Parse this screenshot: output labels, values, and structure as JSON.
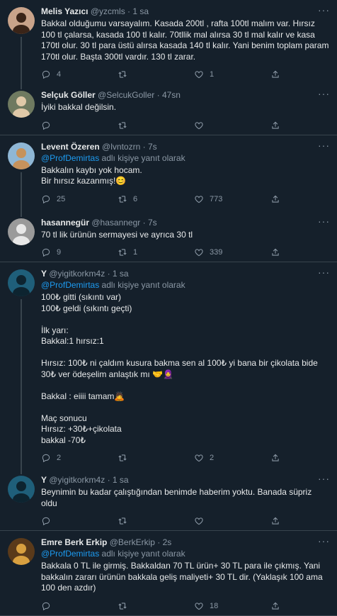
{
  "tweets": [
    {
      "name": "Melis Yazıcı",
      "handle": "@yzcmls",
      "time": "1 sa",
      "reply_prefix": "",
      "reply_mention": "",
      "reply_suffix": "",
      "text": "Bakkal olduğumu varsayalım. Kasada 200tl , rafta 100tl malım var. Hırsız 100 tl çalarsa, kasada 100 tl kalır. 70tllik mal alırsa 30 tl mal kalır ve kasa 170tl olur. 30 tl para üstü alırsa kasada 140 tl kalır. Yani benim toplam param 170tl olur. Başta 300tl vardır. 130 tl zarar.",
      "replies": "4",
      "retweets": "",
      "likes": "1",
      "avatar": {
        "bg": "#c9a38a",
        "fg": "#3a2418"
      }
    },
    {
      "name": "Selçuk Göller",
      "handle": "@SelcukGoller",
      "time": "47sn",
      "reply_prefix": "",
      "reply_mention": "",
      "reply_suffix": "",
      "text": "İyiki bakkal değilsin.",
      "replies": "",
      "retweets": "",
      "likes": "",
      "avatar": {
        "bg": "#6f7a60",
        "fg": "#e0c9a8"
      }
    },
    {
      "name": "Levent Özeren",
      "handle": "@lvntozrn",
      "time": "7s",
      "reply_prefix": "",
      "reply_mention": "@ProfDemirtas",
      "reply_suffix": " adlı kişiye yanıt olarak",
      "text": "Bakkalın kaybı yok hocam.\nBir hırsız kazanmış!😊",
      "replies": "25",
      "retweets": "6",
      "likes": "773",
      "avatar": {
        "bg": "#8fb7d6",
        "fg": "#c6925c"
      }
    },
    {
      "name": "hasannegür",
      "handle": "@hasannegr",
      "time": "7s",
      "reply_prefix": "",
      "reply_mention": "",
      "reply_suffix": "",
      "text": "70 tl lik ürünün sermayesi ve ayrıca 30 tl",
      "replies": "9",
      "retweets": "1",
      "likes": "339",
      "avatar": {
        "bg": "#9a9a9a",
        "fg": "#e8e8e8"
      }
    },
    {
      "name": "Y",
      "handle": "@yigitkorkm4z",
      "time": "1 sa",
      "reply_prefix": "",
      "reply_mention": "@ProfDemirtas",
      "reply_suffix": " adlı kişiye yanıt olarak",
      "text": "100₺ gitti (sıkıntı var)\n100₺ geldi (sıkıntı geçti)\n\nİlk yarı:\nBakkal:1 hırsız:1\n\nHırsız: 100₺ ni çaldım kusura bakma sen al 100₺ yi bana bir çikolata bide 30₺ ver ödeşelim anlaştık mı 🤝🧕\n\nBakkal : eiiii tamam🙇\n\nMaç sonucu\nHırsız: +30₺+çikolata\nbakkal -70₺",
      "replies": "2",
      "retweets": "",
      "likes": "2",
      "avatar": {
        "bg": "#1f5f7a",
        "fg": "#0d2430"
      }
    },
    {
      "name": "Y",
      "handle": "@yigitkorkm4z",
      "time": "1 sa",
      "reply_prefix": "",
      "reply_mention": "",
      "reply_suffix": "",
      "text": "Beynimin bu kadar çalıştığından benimde haberim yoktu. Banada süpriz oldu",
      "replies": "",
      "retweets": "",
      "likes": "",
      "avatar": {
        "bg": "#1f5f7a",
        "fg": "#0d2430"
      }
    },
    {
      "name": "Emre Berk Erkip",
      "handle": "@BerkErkip",
      "time": "2s",
      "reply_prefix": "",
      "reply_mention": "@ProfDemirtas",
      "reply_suffix": " adlı kişiye yanıt olarak",
      "text": "Bakkala 0 TL ile girmiş. Bakkaldan 70 TL ürün+ 30 TL para ile çıkmış. Yani bakkalın zararı ürünün bakkala geliş maliyeti+ 30 TL dir. (Yaklaşık 100 ama 100 den azdır)",
      "replies": "",
      "retweets": "",
      "likes": "18",
      "avatar": {
        "bg": "#5a3a1a",
        "fg": "#d8a040"
      }
    }
  ],
  "colors": {
    "background": "#15202b",
    "divider": "#38444d",
    "muted": "#8b98a5",
    "link": "#1d9bf0"
  },
  "icons": [
    "reply-icon",
    "retweet-icon",
    "like-icon",
    "share-icon",
    "more-icon"
  ]
}
